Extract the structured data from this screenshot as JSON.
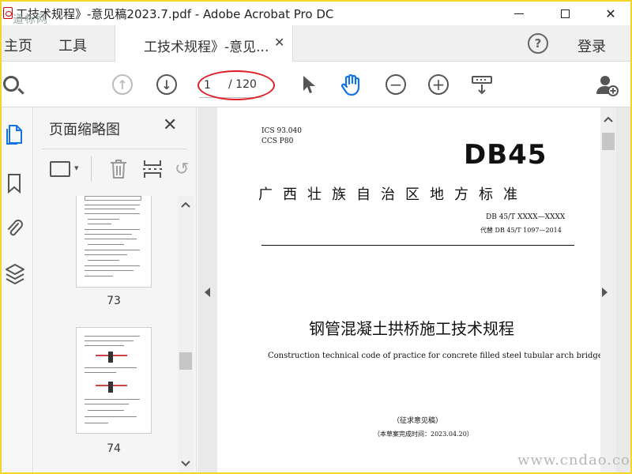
{
  "window": {
    "title": "工技术规程》-意见稿2023.7.pdf - Adobe Acrobat Pro DC",
    "watermark": "道标网",
    "min_icon": "minimize-icon",
    "max_icon": "maximize-icon",
    "close_glyph": "✕"
  },
  "tabs": {
    "home": "主页",
    "tools": "工具",
    "document": "工技术规程》-意见...",
    "close_glyph": "✕",
    "help_glyph": "?",
    "login": "登录"
  },
  "toolbar": {
    "page_current": "1",
    "page_total": "/ 120",
    "zoom_out_glyph": "−",
    "zoom_in_glyph": "+",
    "prev_glyph": "↑",
    "next_glyph": "↓",
    "annotation_color": "#e31b23"
  },
  "thumbnails": {
    "title": "页面缩略图",
    "close_glyph": "✕",
    "caret": "▾",
    "rotate_glyph": "↺",
    "pages": [
      {
        "label": "73"
      },
      {
        "label": "74"
      }
    ]
  },
  "page": {
    "ics": "ICS  93.040",
    "ccs": "CCS  P80",
    "logo": "DB45",
    "region_standard": "广西壮族自治区地方标准",
    "number": "DB 45/T XXXX—XXXX",
    "replaces": "代替 DB 45/T 1097—2014",
    "title_cn": "钢管混凝土拱桥施工技术规程",
    "title_en": "Construction technical code of practice for concrete filled steel tubular arch bridges",
    "draft": "（征求意见稿）",
    "draft_date": "（本草案完成时间：2023.04.20）",
    "watermark": "www.cndao.com"
  },
  "colors": {
    "frame": "#f3d629",
    "accent": "#1473e6"
  }
}
